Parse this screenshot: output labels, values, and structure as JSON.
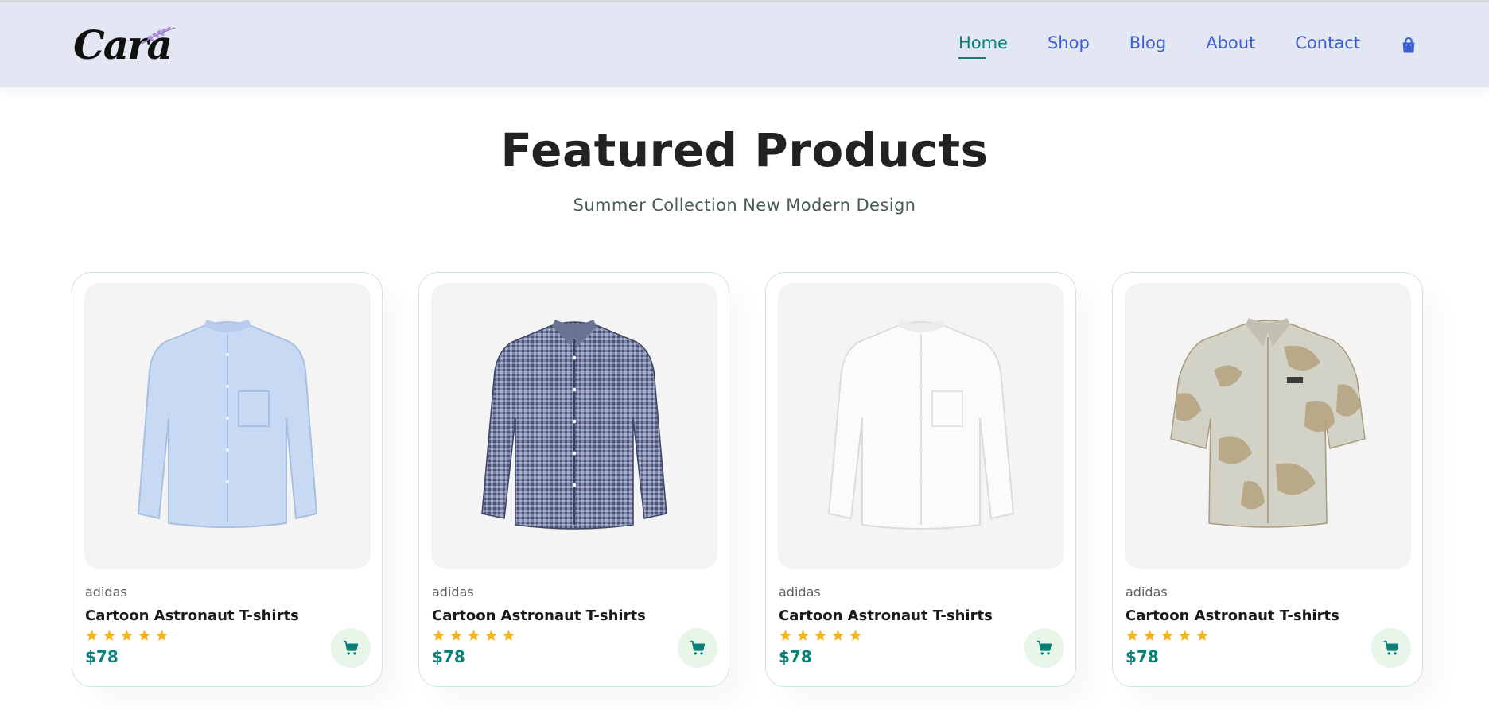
{
  "header": {
    "logo_text": "Cara",
    "nav": [
      {
        "label": "Home",
        "active": true
      },
      {
        "label": "Shop",
        "active": false
      },
      {
        "label": "Blog",
        "active": false
      },
      {
        "label": "About",
        "active": false
      },
      {
        "label": "Contact",
        "active": false
      }
    ],
    "cart_icon": "shopping-bag-icon"
  },
  "section": {
    "title": "Featured Products",
    "subtitle": "Summer Collection New Modern Design"
  },
  "products": [
    {
      "brand": "adidas",
      "name": "Cartoon Astronaut T-shirts",
      "rating": 5,
      "price": "$78",
      "image": "light-blue-shirt"
    },
    {
      "brand": "adidas",
      "name": "Cartoon Astronaut T-shirts",
      "rating": 5,
      "price": "$78",
      "image": "navy-check-shirt"
    },
    {
      "brand": "adidas",
      "name": "Cartoon Astronaut T-shirts",
      "rating": 5,
      "price": "$78",
      "image": "white-shirt"
    },
    {
      "brand": "adidas",
      "name": "Cartoon Astronaut T-shirts",
      "rating": 5,
      "price": "$78",
      "image": "floral-short-sleeve-shirt"
    }
  ],
  "colors": {
    "accent": "#088178",
    "nav_link": "#3b5fd4",
    "header_bg": "#e3e6f3",
    "star": "#f3b519",
    "cart_bg": "#e8f6ea"
  }
}
